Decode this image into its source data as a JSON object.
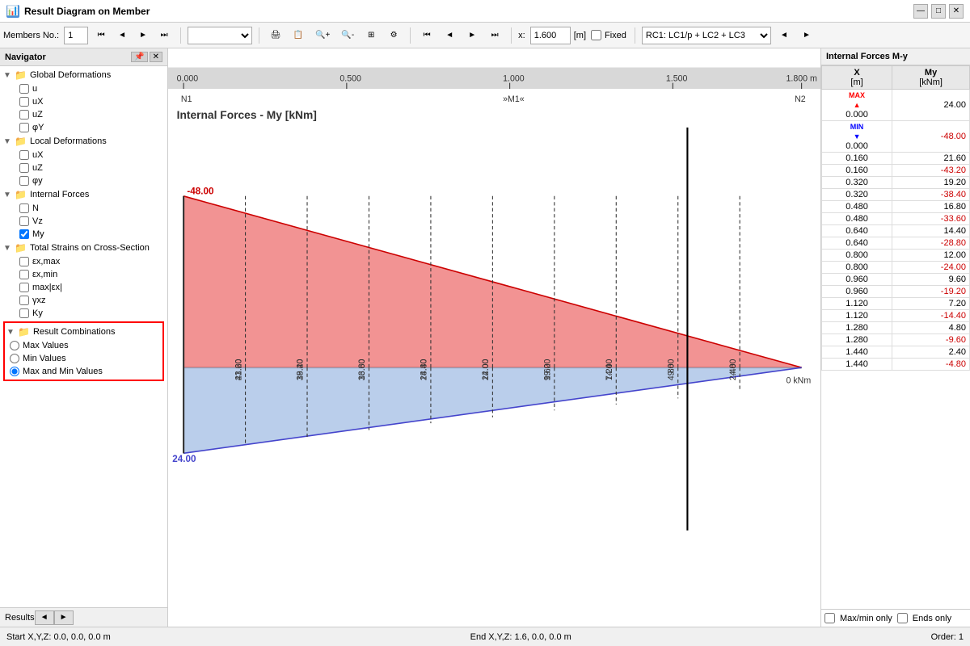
{
  "window": {
    "title": "Result Diagram on Member",
    "controls": [
      "—",
      "□",
      "✕"
    ]
  },
  "toolbar": {
    "members_label": "Members No.:",
    "members_value": "1",
    "x_label": "x:",
    "x_value": "1.600",
    "x_unit": "[m]",
    "fixed_label": "Fixed",
    "rc_label": "RC1: LC1/p + LC2 + LC3"
  },
  "navigator": {
    "title": "Navigator",
    "groups": [
      {
        "label": "Global Deformations",
        "items": [
          "u",
          "uX",
          "uZ",
          "φY"
        ]
      },
      {
        "label": "Local Deformations",
        "items": [
          "uX",
          "uZ",
          "φy"
        ]
      },
      {
        "label": "Internal Forces",
        "items": [
          "N",
          "Vz",
          "My"
        ],
        "checked": [
          "My"
        ]
      },
      {
        "label": "Total Strains on Cross-Section",
        "items": [
          "εx,max",
          "εx,min",
          "max|εx|",
          "γxz",
          "Ky"
        ]
      }
    ],
    "result_combinations": {
      "label": "Result Combinations",
      "options": [
        "Max Values",
        "Min Values",
        "Max and Min Values"
      ],
      "selected": "Max and Min Values"
    }
  },
  "diagram": {
    "title": "Internal Forces - My [kNm]",
    "ruler_marks": [
      "0.000",
      "0.500",
      "1.000",
      "1.500",
      "1.800 m"
    ],
    "node_labels": [
      "N1",
      "»M1«",
      "N2"
    ],
    "top_values": [
      "48.00",
      "43.20",
      "38.40",
      "33.60",
      "28.80",
      "24.00",
      "19.20",
      "14.40",
      "9.60",
      "4.80",
      "0 kNm"
    ],
    "bottom_values": [
      "24.00",
      "21.60",
      "19.20",
      "16.80",
      "14.40",
      "12.00",
      "9.60",
      "7.20",
      "4.80",
      "2.40"
    ]
  },
  "right_panel": {
    "title": "Internal Forces M-y",
    "col_x": "X\n[m]",
    "col_my": "My\n[kNm]",
    "max_label": "MAX",
    "min_label": "MIN",
    "rows": [
      {
        "x": "0.000",
        "my": "24.00",
        "type": "max"
      },
      {
        "x": "0.000",
        "my": "-48.00",
        "type": "min"
      },
      {
        "x": "0.160",
        "my": "21.60",
        "type": "normal"
      },
      {
        "x": "0.160",
        "my": "-43.20",
        "type": "normal"
      },
      {
        "x": "0.320",
        "my": "19.20",
        "type": "normal"
      },
      {
        "x": "0.320",
        "my": "-38.40",
        "type": "normal"
      },
      {
        "x": "0.480",
        "my": "16.80",
        "type": "normal"
      },
      {
        "x": "0.480",
        "my": "-33.60",
        "type": "normal"
      },
      {
        "x": "0.640",
        "my": "14.40",
        "type": "normal"
      },
      {
        "x": "0.640",
        "my": "-28.80",
        "type": "normal"
      },
      {
        "x": "0.800",
        "my": "12.00",
        "type": "normal"
      },
      {
        "x": "0.800",
        "my": "-24.00",
        "type": "normal"
      },
      {
        "x": "0.960",
        "my": "9.60",
        "type": "normal"
      },
      {
        "x": "0.960",
        "my": "-19.20",
        "type": "normal"
      },
      {
        "x": "1.120",
        "my": "7.20",
        "type": "normal"
      },
      {
        "x": "1.120",
        "my": "-14.40",
        "type": "normal"
      },
      {
        "x": "1.280",
        "my": "4.80",
        "type": "normal"
      },
      {
        "x": "1.280",
        "my": "-9.60",
        "type": "normal"
      },
      {
        "x": "1.440",
        "my": "2.40",
        "type": "normal"
      },
      {
        "x": "1.440",
        "my": "-4.80",
        "type": "normal"
      }
    ],
    "checkboxes": {
      "max_min_only": "Max/min only",
      "ends_only": "Ends only"
    }
  },
  "status_bar": {
    "start": "Start X,Y,Z:  0.0, 0.0, 0.0 m",
    "end": "End X,Y,Z:  1.6, 0.0, 0.0 m",
    "order": "Order: 1"
  },
  "results_footer": {
    "label": "Results",
    "btn_left": "◄",
    "btn_right": "►"
  }
}
